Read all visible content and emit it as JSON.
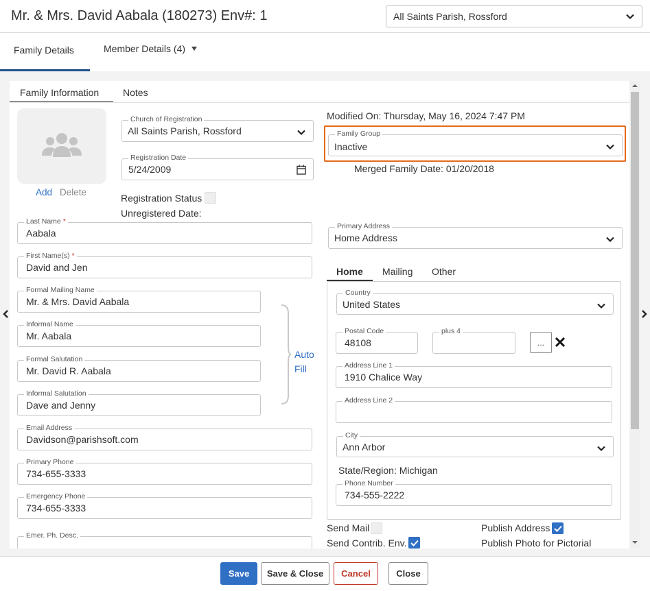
{
  "header": {
    "title": "Mr. & Mrs. David Aabala (180273) Env#: 1",
    "parish_select": "All Saints Parish, Rossford"
  },
  "main_tabs": [
    {
      "label": "Family Details"
    },
    {
      "label": "Member Details (4)"
    }
  ],
  "sub_tabs": [
    {
      "label": "Family Information"
    },
    {
      "label": "Notes"
    }
  ],
  "photo": {
    "add": "Add",
    "delete": "Delete"
  },
  "church_of_registration": {
    "label": "Church of Registration",
    "value": "All Saints Parish, Rossford"
  },
  "registration_date": {
    "label": "Registration Date",
    "value": "5/24/2009"
  },
  "registration_status": {
    "label": "Registration Status"
  },
  "unregistered_date": {
    "label": "Unregistered Date:"
  },
  "modified_on": "Modified On: Thursday, May 16, 2024 7:47 PM",
  "family_group": {
    "label": "Family Group",
    "value": "Inactive"
  },
  "merged_family_date": "Merged Family Date: 01/20/2018",
  "fields": {
    "last_name": {
      "label": "Last Name",
      "value": "Aabala"
    },
    "first_names": {
      "label": "First Name(s)",
      "value": "David and Jen"
    },
    "formal_mailing_name": {
      "label": "Formal Mailing Name",
      "value": "Mr. & Mrs. David Aabala"
    },
    "informal_name": {
      "label": "Informal Name",
      "value": "Mr. Aabala"
    },
    "formal_salutation": {
      "label": "Formal Salutation",
      "value": "Mr. David R. Aabala"
    },
    "informal_salutation": {
      "label": "Informal Salutation",
      "value": "Dave and Jenny"
    },
    "email_address": {
      "label": "Email Address",
      "value": "Davidson@parishsoft.com"
    },
    "primary_phone": {
      "label": "Primary Phone",
      "value": "734-655-3333"
    },
    "emergency_phone": {
      "label": "Emergency Phone",
      "value": "734-655-3333"
    },
    "emer_ph_desc": {
      "label": "Emer. Ph. Desc.",
      "value": ""
    }
  },
  "auto_fill": {
    "line1": "Auto",
    "line2": "Fill"
  },
  "primary_address": {
    "label": "Primary Address",
    "value": "Home Address"
  },
  "address_tabs": [
    {
      "label": "Home"
    },
    {
      "label": "Mailing"
    },
    {
      "label": "Other"
    }
  ],
  "address": {
    "country": {
      "label": "Country",
      "value": "United States"
    },
    "postal_code": {
      "label": "Postal Code",
      "value": "48108"
    },
    "plus4": {
      "label": "plus 4",
      "value": ""
    },
    "lookup_button": "...",
    "address_line1": {
      "label": "Address Line 1",
      "value": "1910 Chalice Way"
    },
    "address_line2": {
      "label": "Address Line 2",
      "value": ""
    },
    "city": {
      "label": "City",
      "value": "Ann Arbor"
    },
    "state_region": "State/Region: Michigan",
    "phone_number": {
      "label": "Phone Number",
      "value": "734-555-2222"
    }
  },
  "checkboxes": {
    "send_mail": {
      "label": "Send Mail",
      "checked": false
    },
    "publish_address": {
      "label": "Publish Address",
      "checked": true
    },
    "send_contrib_env": {
      "label": "Send Contrib. Env.",
      "checked": true
    },
    "publish_photo": {
      "label": "Publish Photo for Pictorial"
    }
  },
  "footer": {
    "save": "Save",
    "save_close": "Save & Close",
    "cancel": "Cancel",
    "close": "Close"
  },
  "colors": {
    "accent": "#2f6fc4",
    "highlight": "#e46a1b",
    "danger": "#c0392b",
    "tab_underline": "#1f4e8c"
  }
}
